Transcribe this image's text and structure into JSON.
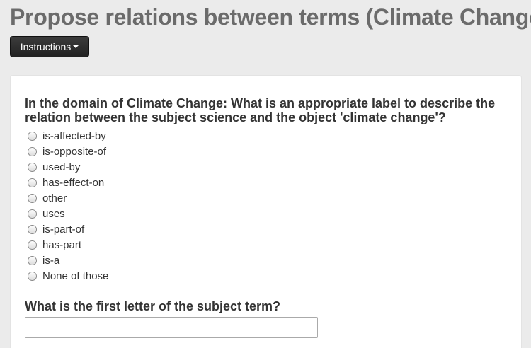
{
  "page": {
    "title": "Propose relations between terms (Climate Change)",
    "instructions_label": "Instructions"
  },
  "form": {
    "question1": "In the domain of Climate Change: What is an appropriate label to describe the relation between the subject science and the object 'climate change'?",
    "options": [
      "is-affected-by",
      "is-opposite-of",
      "used-by",
      "has-effect-on",
      "other",
      "uses",
      "is-part-of",
      "has-part",
      "is-a",
      "None of those"
    ],
    "question2": "What is the first letter of the subject term?",
    "answer_value": ""
  }
}
